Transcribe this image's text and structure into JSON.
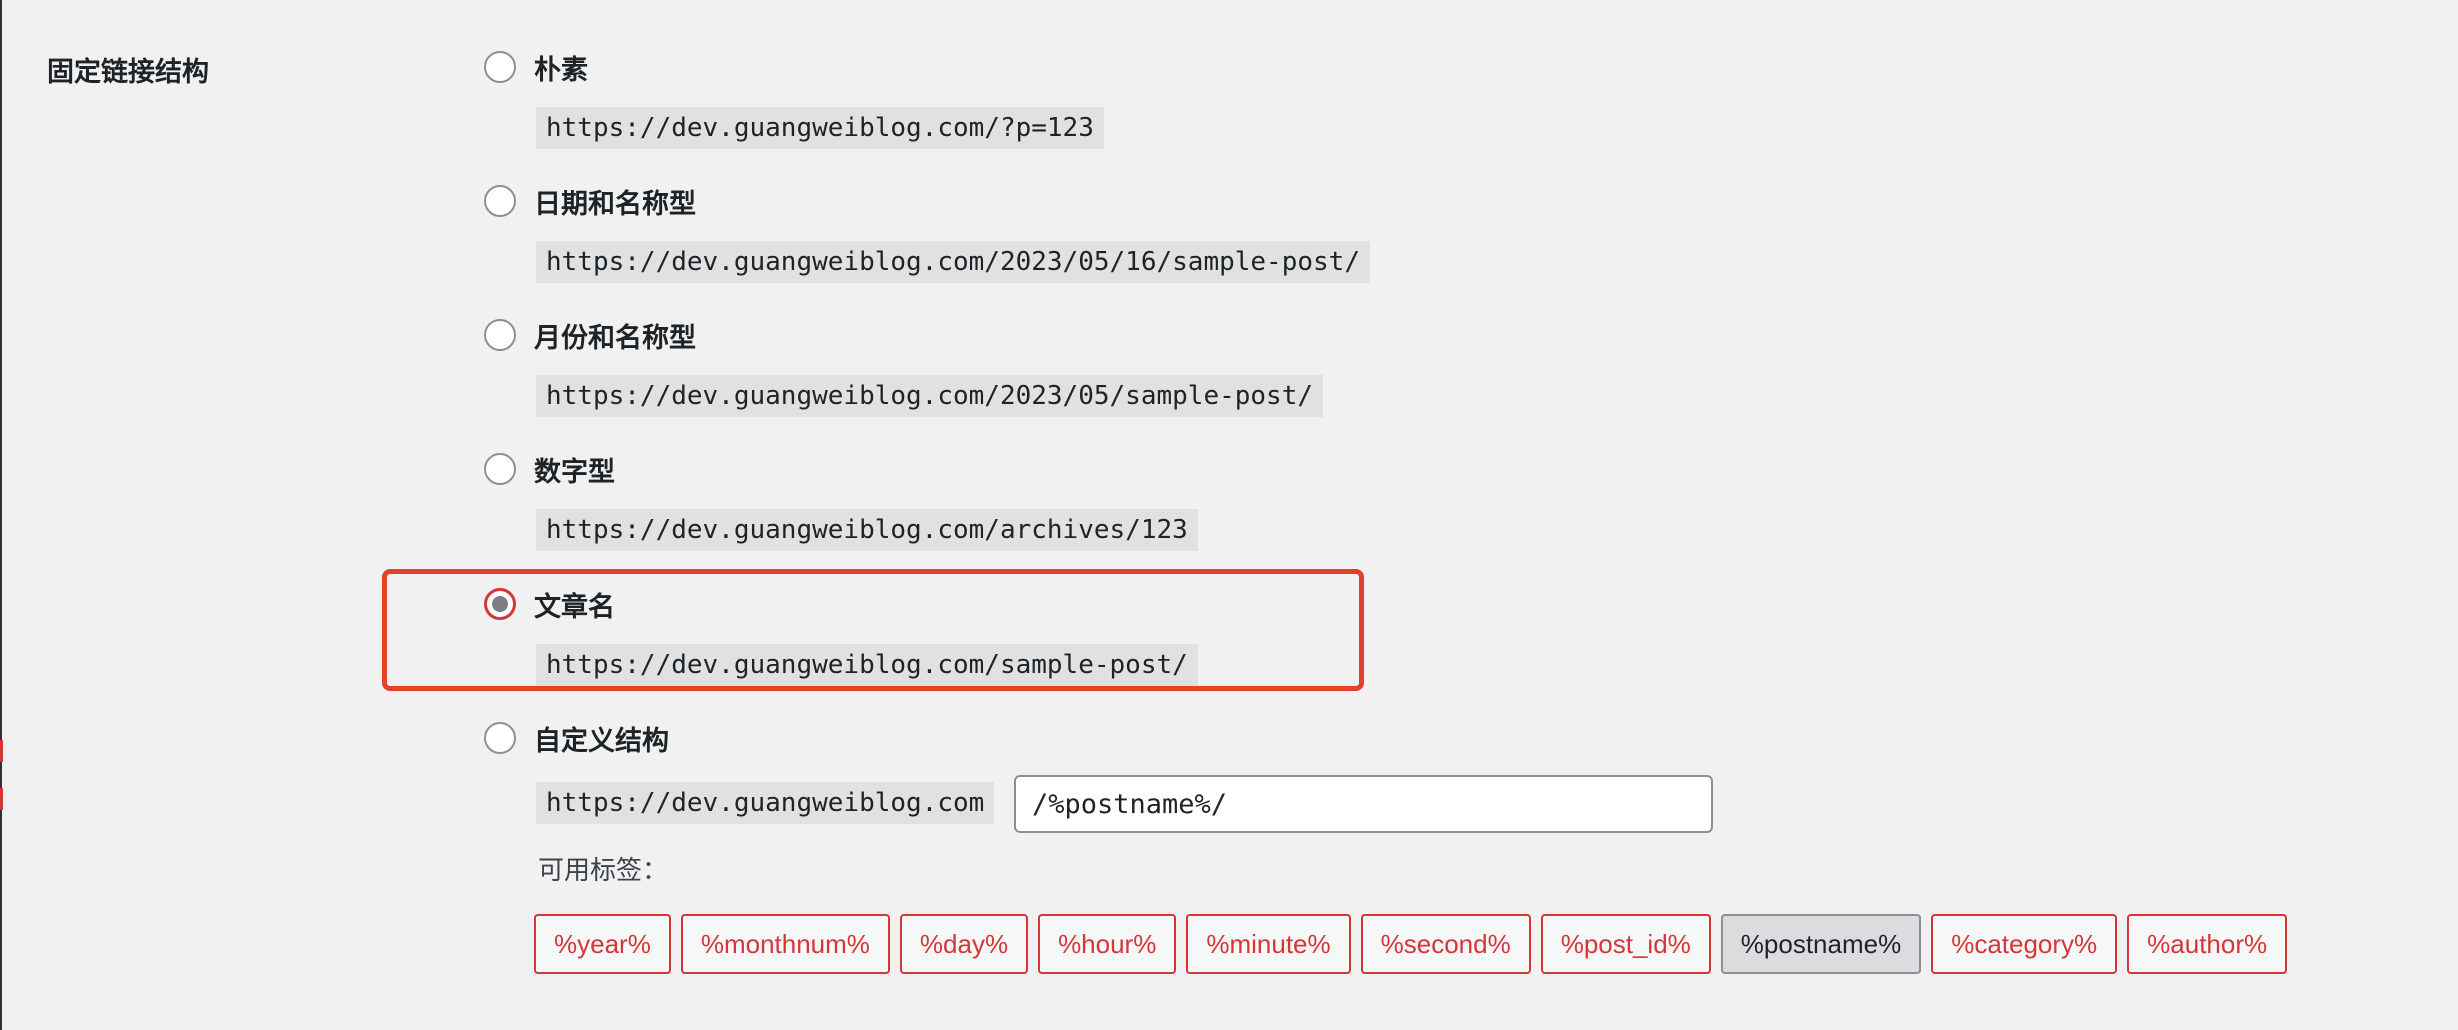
{
  "section": {
    "title": "固定链接结构"
  },
  "options": [
    {
      "label": "朴素",
      "example": "https://dev.guangweiblog.com/?p=123",
      "checked": false
    },
    {
      "label": "日期和名称型",
      "example": "https://dev.guangweiblog.com/2023/05/16/sample-post/",
      "checked": false
    },
    {
      "label": "月份和名称型",
      "example": "https://dev.guangweiblog.com/2023/05/sample-post/",
      "checked": false
    },
    {
      "label": "数字型",
      "example": "https://dev.guangweiblog.com/archives/123",
      "checked": false
    },
    {
      "label": "文章名",
      "example": "https://dev.guangweiblog.com/sample-post/",
      "checked": true
    }
  ],
  "custom": {
    "label": "自定义结构",
    "base": "https://dev.guangweiblog.com",
    "value": "/%postname%/",
    "checked": false
  },
  "tags": {
    "label": "可用标签：",
    "items": [
      "%year%",
      "%monthnum%",
      "%day%",
      "%hour%",
      "%minute%",
      "%second%",
      "%post_id%",
      "%postname%",
      "%category%",
      "%author%"
    ],
    "active": "%postname%"
  },
  "colors": {
    "highlight": "#e2422d",
    "tag_accent": "#d63638"
  }
}
